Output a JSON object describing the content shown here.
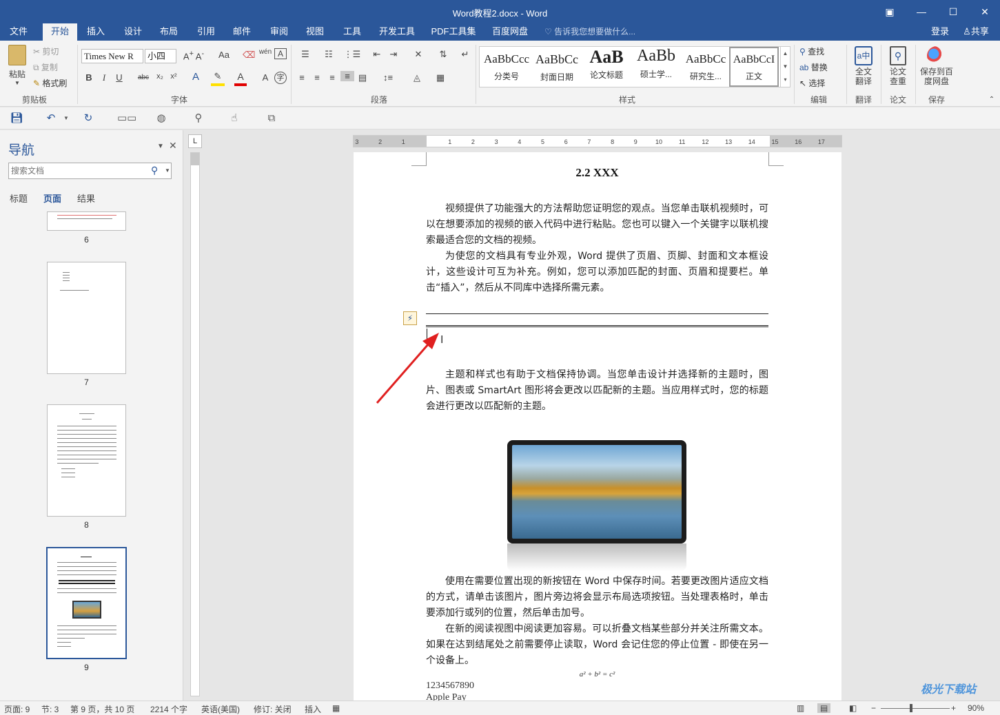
{
  "window": {
    "title": "Word教程2.docx - Word"
  },
  "tabs": [
    "文件",
    "开始",
    "插入",
    "设计",
    "布局",
    "引用",
    "邮件",
    "审阅",
    "视图",
    "工具",
    "开发工具",
    "PDF工具集",
    "百度网盘"
  ],
  "active_tab": "开始",
  "tell_me": "告诉我您想要做什么...",
  "account": {
    "login": "登录",
    "share": "共享"
  },
  "ribbon": {
    "clipboard": {
      "paste": "粘贴",
      "cut": "剪切",
      "copy": "复制",
      "format_painter": "格式刷",
      "label": "剪贴板"
    },
    "font": {
      "name": "Times New R",
      "size": "小四",
      "label": "字体"
    },
    "paragraph": {
      "label": "段落"
    },
    "styles": {
      "items": [
        {
          "sample": "AaBbCcc",
          "name": "分类号"
        },
        {
          "sample": "AaBbCc",
          "name": "封面日期"
        },
        {
          "sample": "AaB",
          "name": "论文标题"
        },
        {
          "sample": "AaBb",
          "name": "硕士学..."
        },
        {
          "sample": "AaBbCc",
          "name": "研究生..."
        },
        {
          "sample": "AaBbCcI",
          "name": "正文"
        }
      ],
      "label": "样式"
    },
    "editing": {
      "find": "查找",
      "replace": "替换",
      "select": "选择",
      "label": "编辑"
    },
    "translate": {
      "btn": "全文翻译",
      "label": "翻译"
    },
    "paper": {
      "btn": "论文查重",
      "label": "论文"
    },
    "save": {
      "btn": "保存到百度网盘",
      "label": "保存"
    }
  },
  "nav": {
    "title": "导航",
    "search_placeholder": "搜索文档",
    "tabs": [
      "标题",
      "页面",
      "结果"
    ],
    "active_tab": "页面",
    "pages": [
      "6",
      "7",
      "8",
      "9"
    ],
    "current_page": "9"
  },
  "document": {
    "heading": "2.2 XXX",
    "paragraphs": [
      "视频提供了功能强大的方法帮助您证明您的观点。当您单击联机视频时，可以在想要添加的视频的嵌入代码中进行粘贴。您也可以键入一个关键字以联机搜索最适合您的文档的视频。",
      "为使您的文档具有专业外观，Word 提供了页眉、页脚、封面和文本框设计，这些设计可互为补充。例如，您可以添加匹配的封面、页眉和提要栏。单击“插入”，然后从不同库中选择所需元素。",
      "主题和样式也有助于文档保持协调。当您单击设计并选择新的主题时，图片、图表或 SmartArt 图形将会更改以匹配新的主题。当应用样式时，您的标题会进行更改以匹配新的主题。",
      "使用在需要位置出现的新按钮在 Word 中保存时间。若要更改图片适应文档的方式，请单击该图片，图片旁边将会显示布局选项按钮。当处理表格时，单击要添加行或列的位置，然后单击加号。",
      "在新的阅读视图中阅读更加容易。可以折叠文档某些部分并关注所需文本。如果在达到结尾处之前需要停止读取，Word 会记住您的停止位置 - 即使在另一个设备上。"
    ],
    "equation": "a² + b² = c²",
    "line1": "1234567890",
    "line2": "Apple Pay"
  },
  "ruler": {
    "h_ticks": [
      "3",
      "2",
      "1",
      "1",
      "2",
      "3",
      "4",
      "5",
      "6",
      "7",
      "8",
      "9",
      "10",
      "11",
      "12",
      "13",
      "14",
      "15",
      "16",
      "17"
    ]
  },
  "status": {
    "page": "页面: 9",
    "section": "节: 3",
    "page_of": "第 9 页，共 10 页",
    "words": "2214 个字",
    "lang": "英语(美国)",
    "track": "修订: 关闭",
    "insert": "插入",
    "zoom": "90%"
  },
  "watermark": "极光下载站",
  "colors": {
    "accent": "#2b579a",
    "arrow": "#e02020"
  }
}
